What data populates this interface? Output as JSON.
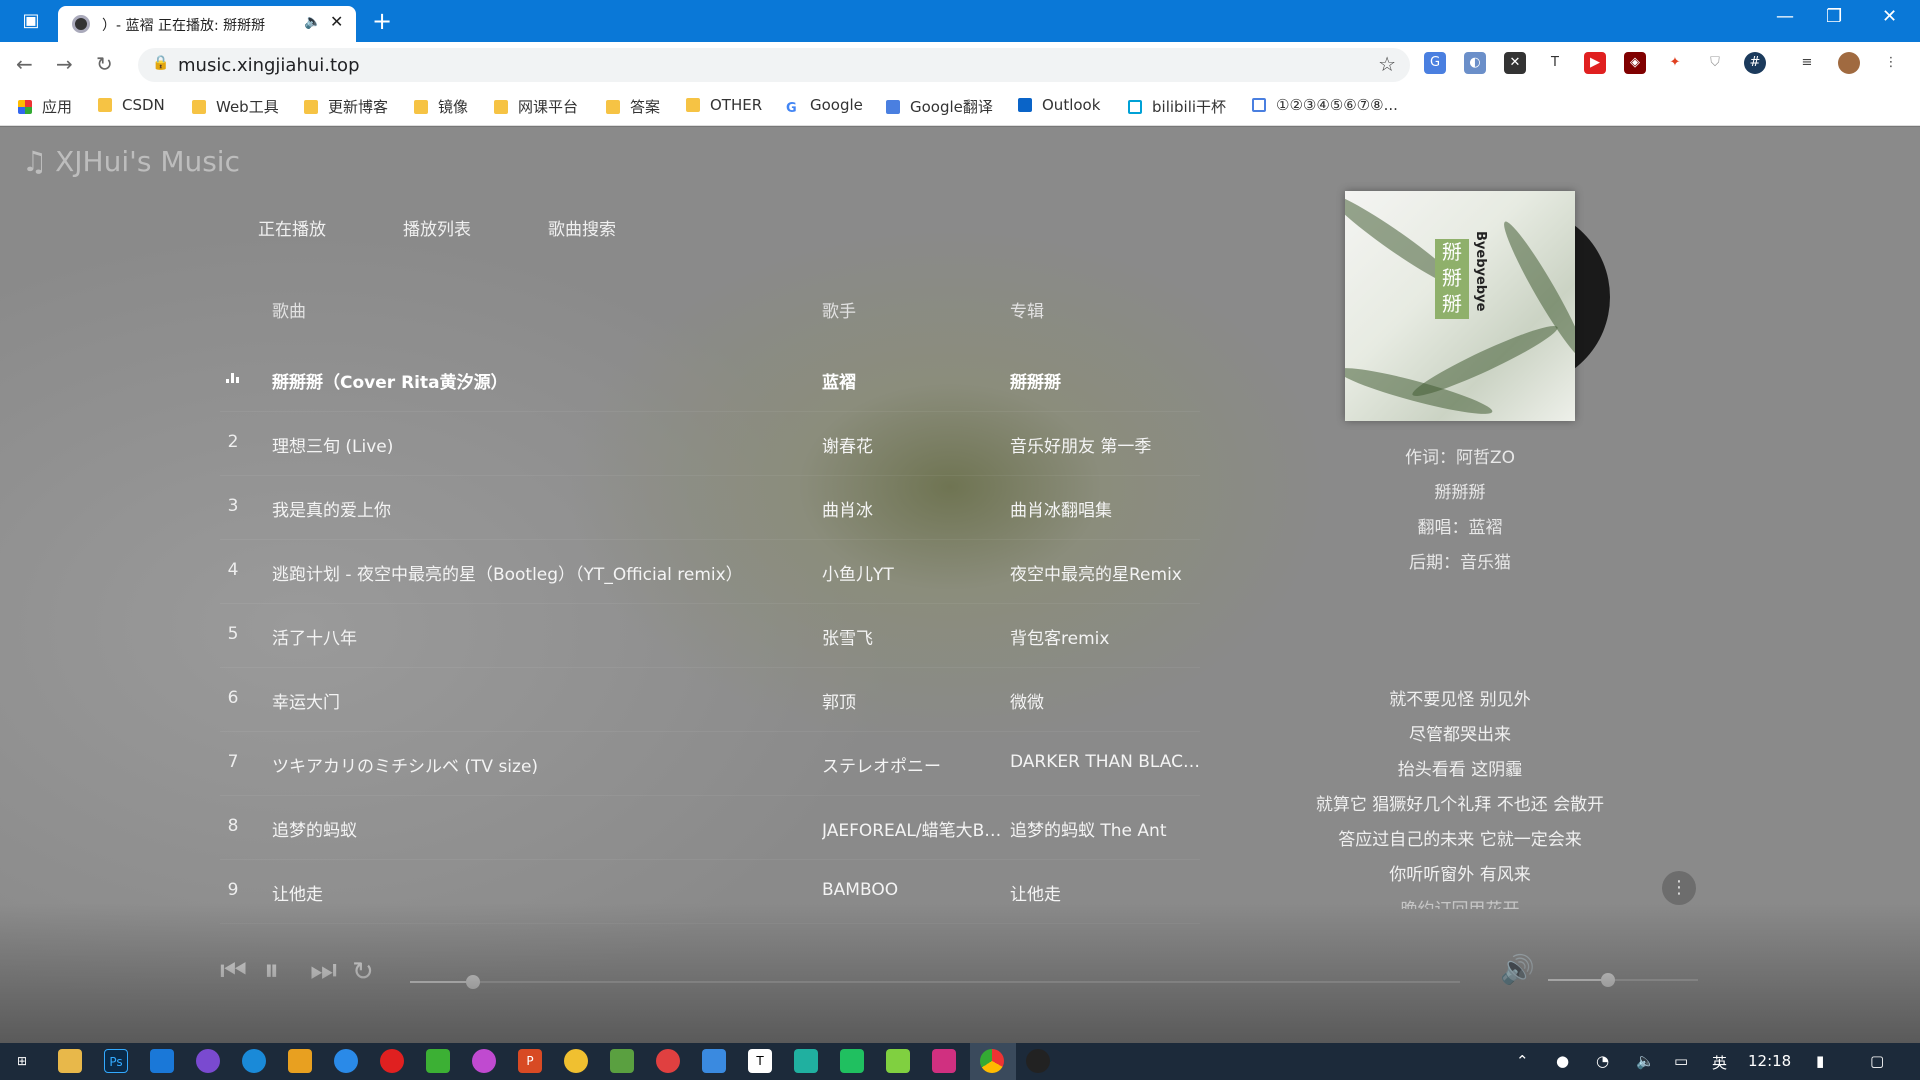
{
  "browser": {
    "tab_title": "）- 蓝褶 正在播放: 掰掰掰",
    "url": "music.xingjiahui.top",
    "bookmarks": [
      {
        "label": "应用",
        "icon": "apps-grid-icon"
      },
      {
        "label": "CSDN",
        "icon": "folder-icon"
      },
      {
        "label": "Web工具",
        "icon": "folder-icon"
      },
      {
        "label": "更新博客",
        "icon": "folder-icon"
      },
      {
        "label": "镜像",
        "icon": "folder-icon"
      },
      {
        "label": "网课平台",
        "icon": "folder-icon"
      },
      {
        "label": "答案",
        "icon": "folder-icon"
      },
      {
        "label": "OTHER",
        "icon": "folder-icon"
      },
      {
        "label": "Google",
        "icon": "google-icon"
      },
      {
        "label": "Google翻译",
        "icon": "google-translate-icon"
      },
      {
        "label": "Outlook",
        "icon": "outlook-icon"
      },
      {
        "label": "bilibili干杯",
        "icon": "bilibili-icon"
      },
      {
        "label": "①②③④⑤⑥⑦⑧...",
        "icon": "word-icon"
      }
    ]
  },
  "app": {
    "logo": "XJHui's Music",
    "menu": [
      "正在播放",
      "播放列表",
      "歌曲搜索"
    ],
    "columns": {
      "song": "歌曲",
      "artist": "歌手",
      "album": "专辑"
    },
    "playlist": [
      {
        "num": "",
        "song": "掰掰掰（Cover Rita黄汐源）",
        "artist": "蓝褶",
        "album": "掰掰掰",
        "active": true
      },
      {
        "num": "2",
        "song": "理想三旬 (Live)",
        "artist": "谢春花",
        "album": "音乐好朋友 第一季"
      },
      {
        "num": "3",
        "song": "我是真的爱上你",
        "artist": "曲肖冰",
        "album": "曲肖冰翻唱集"
      },
      {
        "num": "4",
        "song": "逃跑计划 - 夜空中最亮的星（Bootleg）（YT_Official remix）",
        "artist": "小鱼儿YT",
        "album": "夜空中最亮的星Remix"
      },
      {
        "num": "5",
        "song": "活了十八年",
        "artist": "张雪飞",
        "album": "背包客remix"
      },
      {
        "num": "6",
        "song": "幸运大门",
        "artist": "郭顶",
        "album": "微微"
      },
      {
        "num": "7",
        "song": "ツキアカリのミチシルベ (TV size)",
        "artist": "ステレオポニー",
        "album": "DARKER THAN BLACK..."
      },
      {
        "num": "8",
        "song": "追梦的蚂蚁",
        "artist": "JAEFOREAL/蜡笔大Bo...",
        "album": "追梦的蚂蚁 The Ant"
      },
      {
        "num": "9",
        "song": "让他走",
        "artist": "BAMBOO",
        "album": "让他走"
      }
    ],
    "cover": {
      "title": "掰掰掰",
      "subtitle": "Byebyebye"
    },
    "info": [
      "作词：阿哲ZO",
      "掰掰掰",
      "翻唱：蓝褶",
      "后期：音乐猫"
    ],
    "lyrics": [
      "就不要见怪 别见外",
      "尽管都哭出来",
      "抬头看看 这阴霾",
      "就算它 猖獗好几个礼拜 不也还 会散开",
      "答应过自己的未来 它就一定会来",
      "你听听窗外 有风来",
      "晚约订回甲花开"
    ],
    "player": {
      "progress": 0.06,
      "volume": 0.4
    }
  },
  "taskbar": {
    "ime": "英",
    "time": "12:18"
  }
}
